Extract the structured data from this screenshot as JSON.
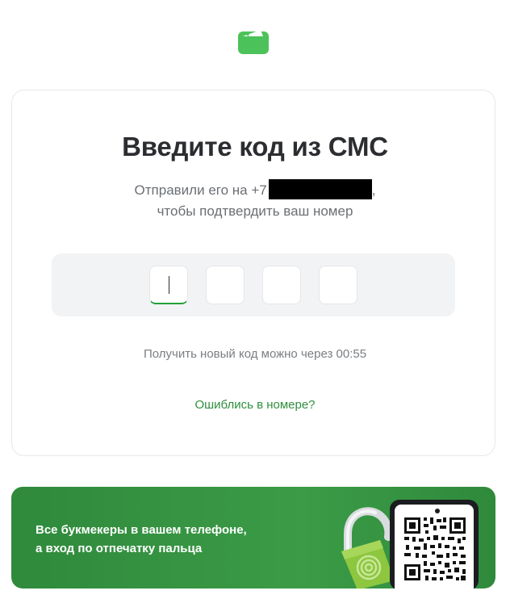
{
  "app": {
    "logo_icon": "wallet-logo-icon",
    "brand_color": "#4cc25a"
  },
  "verify": {
    "title": "Введите код из СМС",
    "subtitle_prefix": "Отправили его на +7",
    "subtitle_suffix": ",",
    "subtitle_line2": "чтобы подтвердить ваш номер",
    "code_length": 4,
    "timer_text": "Получить новый код можно через 00:55",
    "wrong_number_link": "Ошиблись в номере?",
    "accent_color": "#21a038"
  },
  "promo": {
    "line1": "Все букмекеры в вашем телефоне,",
    "line2": "а вход по отпечатку пальца",
    "lock_icon": "fingerprint-lock-icon",
    "qr_icon": "qr-code-icon"
  }
}
